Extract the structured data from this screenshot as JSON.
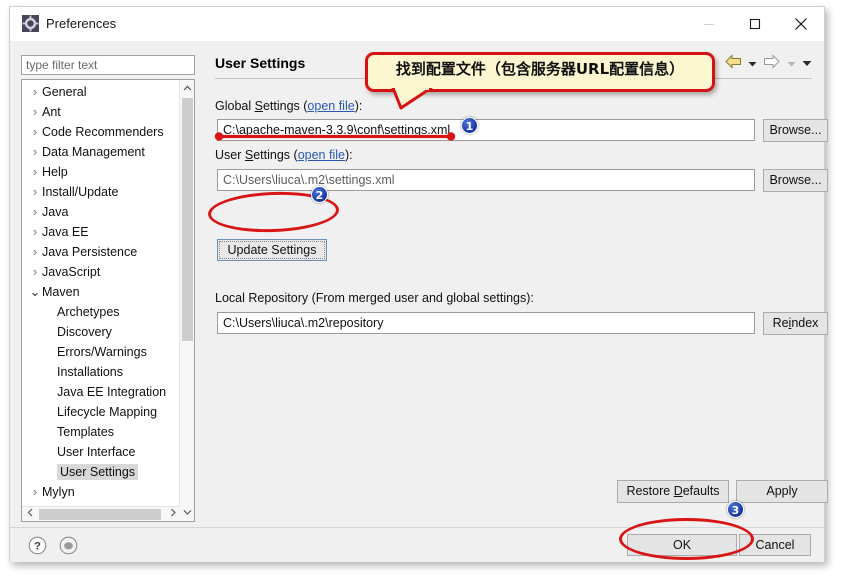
{
  "window": {
    "title": "Preferences",
    "icon": "preferences-gear-icon",
    "controls": {
      "minimize": "–",
      "maximize": "□",
      "close": "✕"
    }
  },
  "sidebar": {
    "filter": {
      "placeholder": "type filter text",
      "value": ""
    },
    "items": [
      {
        "label": "General",
        "expander": "collapsed",
        "level": 0
      },
      {
        "label": "Ant",
        "expander": "collapsed",
        "level": 0
      },
      {
        "label": "Code Recommenders",
        "expander": "collapsed",
        "level": 0
      },
      {
        "label": "Data Management",
        "expander": "collapsed",
        "level": 0
      },
      {
        "label": "Help",
        "expander": "collapsed",
        "level": 0
      },
      {
        "label": "Install/Update",
        "expander": "collapsed",
        "level": 0
      },
      {
        "label": "Java",
        "expander": "collapsed",
        "level": 0
      },
      {
        "label": "Java EE",
        "expander": "collapsed",
        "level": 0
      },
      {
        "label": "Java Persistence",
        "expander": "collapsed",
        "level": 0
      },
      {
        "label": "JavaScript",
        "expander": "collapsed",
        "level": 0
      },
      {
        "label": "Maven",
        "expander": "expanded",
        "level": 0
      },
      {
        "label": "Archetypes",
        "expander": "none",
        "level": 1
      },
      {
        "label": "Discovery",
        "expander": "none",
        "level": 1
      },
      {
        "label": "Errors/Warnings",
        "expander": "none",
        "level": 1
      },
      {
        "label": "Installations",
        "expander": "none",
        "level": 1
      },
      {
        "label": "Java EE Integration",
        "expander": "none",
        "level": 1
      },
      {
        "label": "Lifecycle Mapping",
        "expander": "none",
        "level": 1
      },
      {
        "label": "Templates",
        "expander": "none",
        "level": 1
      },
      {
        "label": "User Interface",
        "expander": "none",
        "level": 1
      },
      {
        "label": "User Settings",
        "expander": "none",
        "level": 1,
        "selected": true
      },
      {
        "label": "Mylyn",
        "expander": "collapsed",
        "level": 0
      }
    ]
  },
  "main": {
    "page_title": "User Settings",
    "toolbar": {
      "back_icon": "back-arrow-icon",
      "back_menu_icon": "chevron-down-icon",
      "forward_icon": "forward-arrow-icon",
      "forward_menu_icon": "chevron-down-icon",
      "overflow_icon": "chevron-down-icon"
    },
    "global_settings": {
      "label_prefix": "Global ",
      "label_accesskey": "S",
      "label_suffix": "ettings (",
      "link": "open file",
      "label_end": "):",
      "value": "C:\\apache-maven-3.3.9\\conf\\settings.xml",
      "browse_label": "Browse..."
    },
    "user_settings": {
      "label_prefix": "User ",
      "label_accesskey": "S",
      "label_suffix": "ettings (",
      "link": "open file",
      "label_end": "):",
      "value": "C:\\Users\\liuca\\.m2\\settings.xml",
      "browse_label": "Browse..."
    },
    "update_settings_label": "Update Settings",
    "local_repository": {
      "label": "Local Repository (From merged user and global settings):",
      "value": "C:\\Users\\liuca\\.m2\\repository",
      "reindex_label_prefix": "Re",
      "reindex_accesskey": "i",
      "reindex_label_suffix": "ndex"
    },
    "restore_defaults": {
      "prefix": "Restore ",
      "accesskey": "D",
      "suffix": "efaults"
    },
    "apply_label": "Apply"
  },
  "footer": {
    "help_icon": "help-question-icon",
    "pin_icon": "pin-circle-icon",
    "ok_label": "OK",
    "cancel_label": "Cancel"
  },
  "annotations": {
    "callout_text": "找到配置文件（包含服务器URL配置信息）",
    "badges": [
      "1",
      "2",
      "3"
    ],
    "colors": {
      "annotation_red": "#d81414",
      "callout_fill": "#fbf6cf",
      "badge_blue": "#1230a0",
      "link_blue": "#2a57b3"
    }
  }
}
